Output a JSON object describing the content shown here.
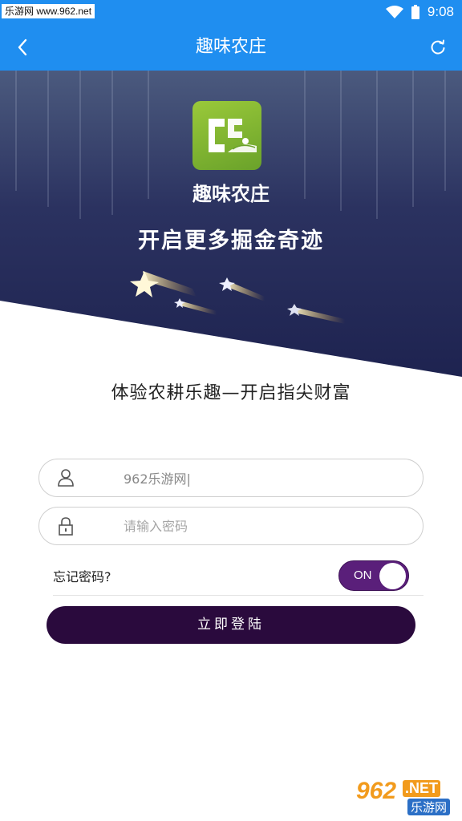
{
  "status_bar": {
    "watermark_text": "乐游网 www.962.net",
    "time": "9:08",
    "icons": [
      "wifi-icon",
      "battery-icon"
    ]
  },
  "nav": {
    "title": "趣味农庄",
    "back_icon": "chevron-left-icon",
    "refresh_icon": "refresh-icon"
  },
  "hero": {
    "app_name": "趣味农庄",
    "slogan": "开启更多掘金奇迹",
    "logo_icon": "farm-logo-icon"
  },
  "tagline": "体验农耕乐趣—开启指尖财富",
  "form": {
    "username": {
      "value": "962乐游网|",
      "icon": "user-icon"
    },
    "password": {
      "placeholder": "请输入密码",
      "icon": "lock-icon"
    },
    "forgot_label": "忘记密码?",
    "toggle_label": "ON",
    "toggle_on": true,
    "login_label": "立即登陆"
  },
  "watermark": {
    "number": "962",
    "suffix": ".NET",
    "cn": "乐游网"
  },
  "colors": {
    "primary": "#1f8ef0",
    "hero_bg": "#252a5a",
    "accent_purple": "#5a1f7a",
    "button_dark": "#2a0a3d",
    "logo_green": "#8cc63f"
  }
}
